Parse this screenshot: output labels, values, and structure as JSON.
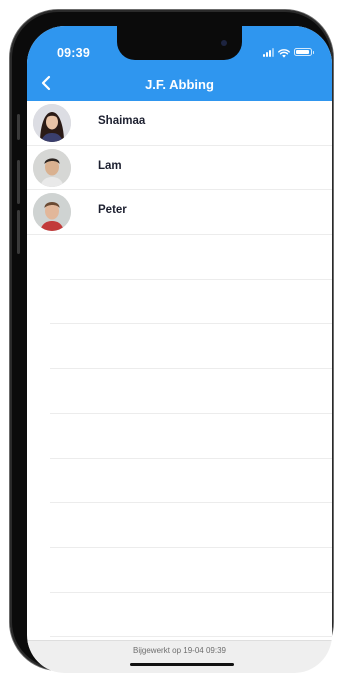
{
  "status_bar": {
    "time": "09:39",
    "icons": [
      "signal-icon",
      "wifi-icon",
      "battery-icon"
    ]
  },
  "header": {
    "title": "J.F. Abbing",
    "back_icon": "chevron-left-icon",
    "background_color": "#2f96ef"
  },
  "people": [
    {
      "name": "Shaimaa",
      "avatar": "avatar-photo"
    },
    {
      "name": "Lam",
      "avatar": "avatar-photo"
    },
    {
      "name": "Peter",
      "avatar": "avatar-photo"
    }
  ],
  "footer": {
    "updated_text": "Bijgewerkt op 19-04 09:39"
  }
}
